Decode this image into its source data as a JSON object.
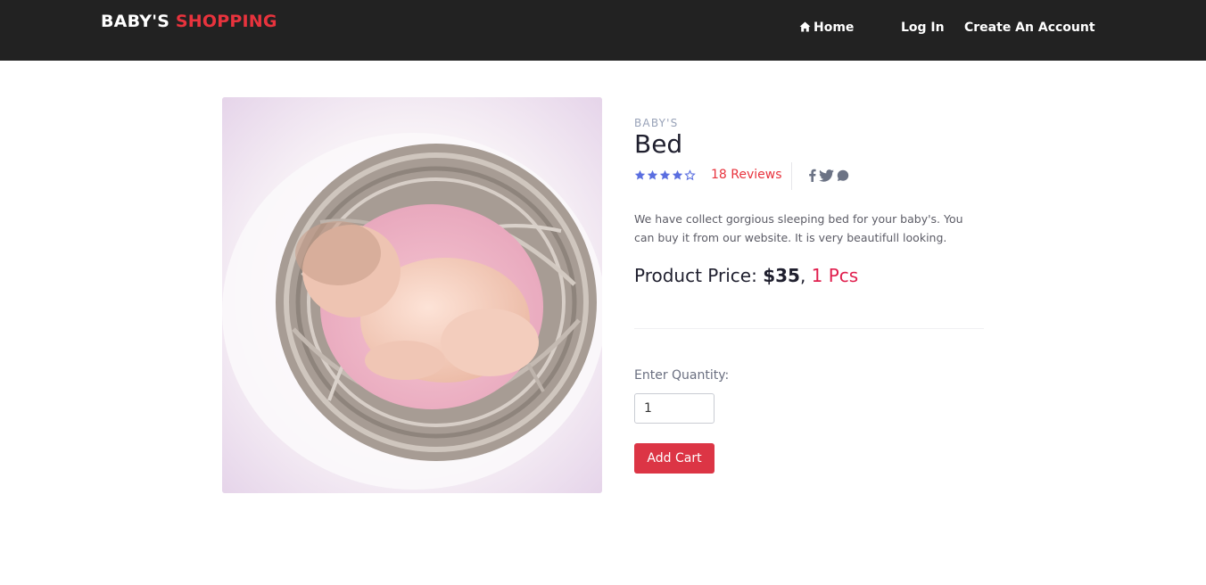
{
  "header": {
    "brand_part1": "BABY'S",
    "brand_part2": "SHOPPING",
    "nav": {
      "home": "Home",
      "login": "Log In",
      "create_account": "Create An Account"
    }
  },
  "product": {
    "category": "BABY'S",
    "title": "Bed",
    "rating": 4,
    "rating_max": 5,
    "reviews_label": "18 Reviews",
    "description": "We have collect gorgious sleeping bed for your baby's. You can buy it from our website. It is very beautifull looking.",
    "price_label": "Product Price:",
    "price_value": "$35",
    "price_sep": ",",
    "quantity_available": "1 Pcs",
    "quantity_label": "Enter Quantity:",
    "quantity_value": "1",
    "add_cart_label": "Add Cart"
  },
  "colors": {
    "accent": "#e8333d",
    "star": "#5a6ee0",
    "navbar": "#222222",
    "button": "#dc3545"
  },
  "icons": {
    "home": "home-icon",
    "social": [
      "facebook-icon",
      "twitter-icon",
      "whatsapp-icon"
    ]
  }
}
